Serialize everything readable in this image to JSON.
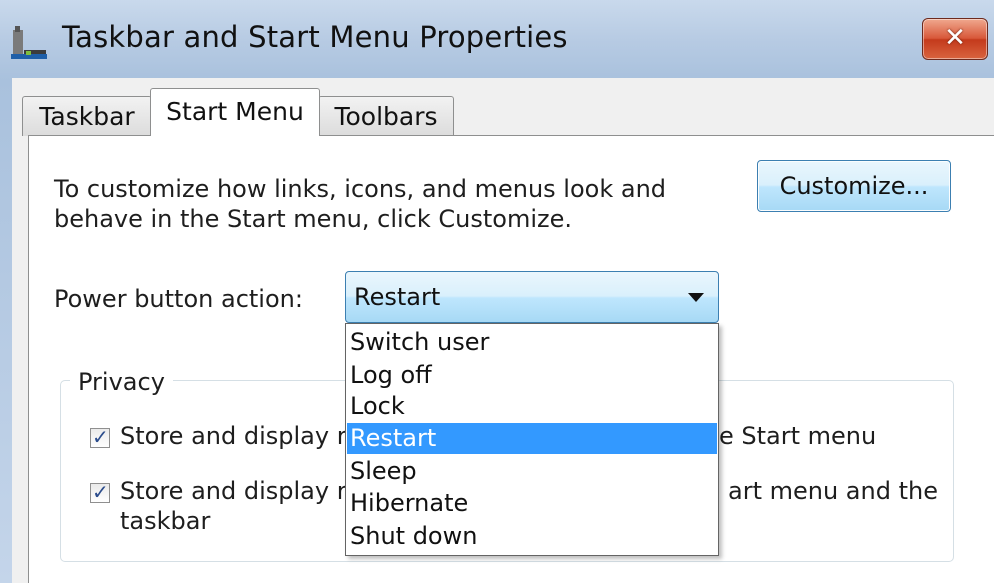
{
  "window": {
    "title": "Taskbar and Start Menu Properties",
    "close_label": "✕"
  },
  "tabs": [
    {
      "label": "Taskbar",
      "active": false
    },
    {
      "label": "Start Menu",
      "active": true
    },
    {
      "label": "Toolbars",
      "active": false
    }
  ],
  "start_menu": {
    "description_line1": "To customize how links, icons, and menus look and",
    "description_line2": "behave in the Start menu, click Customize.",
    "customize_label": "Customize...",
    "power_label": "Power button action:",
    "power_value": "Restart",
    "power_options": [
      "Switch user",
      "Log off",
      "Lock",
      "Restart",
      "Sleep",
      "Hibernate",
      "Shut down"
    ],
    "privacy": {
      "legend": "Privacy",
      "items": [
        {
          "label_left": "Store and display r",
          "label_right": "e Start menu",
          "label_line2": "",
          "checked": true
        },
        {
          "label_left": "Store and display r",
          "label_right": "art menu and the",
          "label_line2": "taskbar",
          "checked": true
        }
      ]
    }
  },
  "colors": {
    "selection": "#3399ff",
    "close_button": "#c43a1c",
    "accent_border": "#3c7fb1"
  },
  "icons": {
    "app": "taskbar-icon",
    "close": "close-icon",
    "dropdown": "chevron-down-icon",
    "check": "checkmark-icon"
  }
}
